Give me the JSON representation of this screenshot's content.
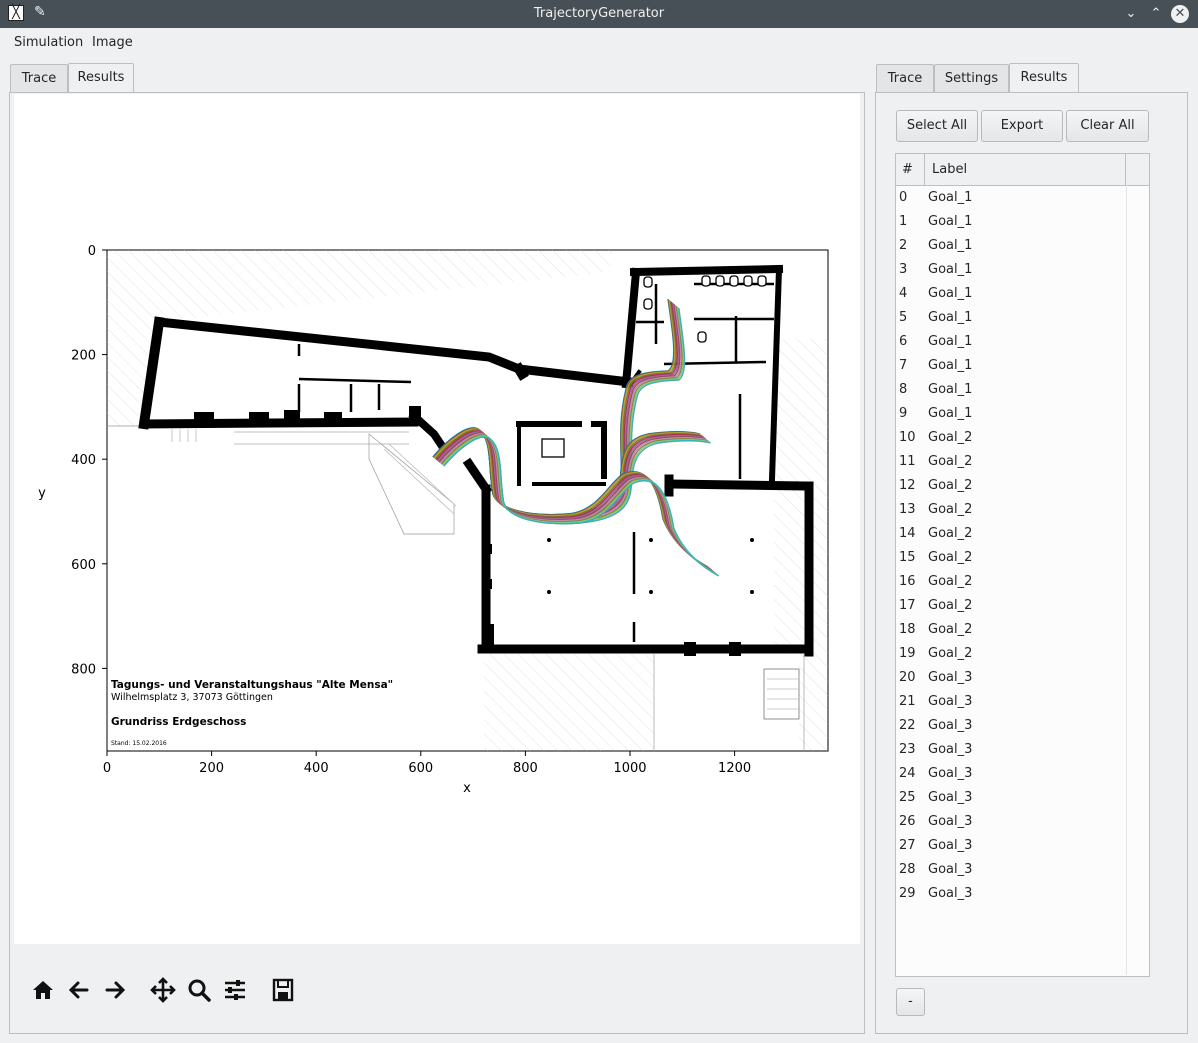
{
  "window": {
    "title": "TrajectoryGenerator",
    "app_icon_glyph": "╳",
    "pin_glyph": "✎",
    "minimize_glyph": "⌄",
    "maximize_glyph": "⌃",
    "close_glyph": "✕"
  },
  "menu": {
    "simulation": "Simulation",
    "image": "Image"
  },
  "left_tabs": {
    "trace": "Trace",
    "results": "Results",
    "active": "Results"
  },
  "right_tabs": {
    "trace": "Trace",
    "settings": "Settings",
    "results": "Results",
    "active": "Results"
  },
  "buttons": {
    "select_all": "Select All",
    "export": "Export",
    "clear_all": "Clear All",
    "remove": "-"
  },
  "table": {
    "col_index": "#",
    "col_label": "Label",
    "rows": [
      {
        "n": "0",
        "label": "Goal_1"
      },
      {
        "n": "1",
        "label": "Goal_1"
      },
      {
        "n": "2",
        "label": "Goal_1"
      },
      {
        "n": "3",
        "label": "Goal_1"
      },
      {
        "n": "4",
        "label": "Goal_1"
      },
      {
        "n": "5",
        "label": "Goal_1"
      },
      {
        "n": "6",
        "label": "Goal_1"
      },
      {
        "n": "7",
        "label": "Goal_1"
      },
      {
        "n": "8",
        "label": "Goal_1"
      },
      {
        "n": "9",
        "label": "Goal_1"
      },
      {
        "n": "10",
        "label": "Goal_2"
      },
      {
        "n": "11",
        "label": "Goal_2"
      },
      {
        "n": "12",
        "label": "Goal_2"
      },
      {
        "n": "13",
        "label": "Goal_2"
      },
      {
        "n": "14",
        "label": "Goal_2"
      },
      {
        "n": "15",
        "label": "Goal_2"
      },
      {
        "n": "16",
        "label": "Goal_2"
      },
      {
        "n": "17",
        "label": "Goal_2"
      },
      {
        "n": "18",
        "label": "Goal_2"
      },
      {
        "n": "19",
        "label": "Goal_2"
      },
      {
        "n": "20",
        "label": "Goal_3"
      },
      {
        "n": "21",
        "label": "Goal_3"
      },
      {
        "n": "22",
        "label": "Goal_3"
      },
      {
        "n": "23",
        "label": "Goal_3"
      },
      {
        "n": "24",
        "label": "Goal_3"
      },
      {
        "n": "25",
        "label": "Goal_3"
      },
      {
        "n": "26",
        "label": "Goal_3"
      },
      {
        "n": "27",
        "label": "Goal_3"
      },
      {
        "n": "28",
        "label": "Goal_3"
      },
      {
        "n": "29",
        "label": "Goal_3"
      }
    ]
  },
  "plot": {
    "xlabel": "x",
    "ylabel": "y",
    "xticks": [
      "0",
      "200",
      "400",
      "600",
      "800",
      "1000",
      "1200"
    ],
    "yticks": [
      "0",
      "200",
      "400",
      "600",
      "800"
    ],
    "floorplan_title": "Tagungs- und Veranstaltungshaus \"Alte Mensa\"",
    "floorplan_address": "Wilhelmsplatz 3, 37073 Göttingen",
    "floorplan_subtitle": "Grundriss Erdgeschoss",
    "floorplan_date": "Stand: 15.02.2016",
    "trajectory_colors": [
      "#1f77b4",
      "#ff7f0e",
      "#2ca02c",
      "#d62728",
      "#9467bd",
      "#8c564b",
      "#e377c2",
      "#7f7f7f",
      "#bcbd22",
      "#17becf"
    ]
  },
  "nav_toolbar": [
    "home-icon",
    "back-icon",
    "forward-icon",
    "pan-icon",
    "zoom-icon",
    "configure-icon",
    "save-icon"
  ]
}
